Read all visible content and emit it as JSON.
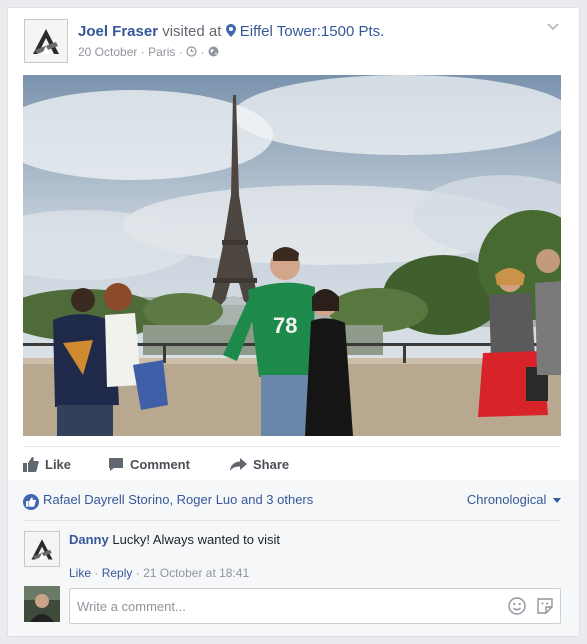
{
  "post": {
    "author": "Joel Fraser",
    "verb": "visited at",
    "place": "Eiffel Tower:1500 Pts.",
    "date": "20 October",
    "location": "Paris",
    "separator": "·"
  },
  "actions": {
    "like": "Like",
    "comment": "Comment",
    "share": "Share"
  },
  "reactions": {
    "summary": "Rafael Dayrell Storino, Roger Luo and 3 others",
    "order": "Chronological"
  },
  "comment": {
    "author": "Danny",
    "text": "Lucky! Always wanted to visit",
    "like": "Like",
    "reply": "Reply",
    "timestamp": "21 October at 18:41"
  },
  "composer": {
    "placeholder": "Write a comment..."
  },
  "colors": {
    "link": "#365899",
    "meta": "#90949c",
    "accent": "#4267b2"
  },
  "icons": [
    "logo-icon",
    "location-pin-icon",
    "clock-icon",
    "globe-icon",
    "chevron-down-icon",
    "like-icon",
    "comment-icon",
    "share-icon",
    "emoji-icon",
    "sticker-icon"
  ]
}
